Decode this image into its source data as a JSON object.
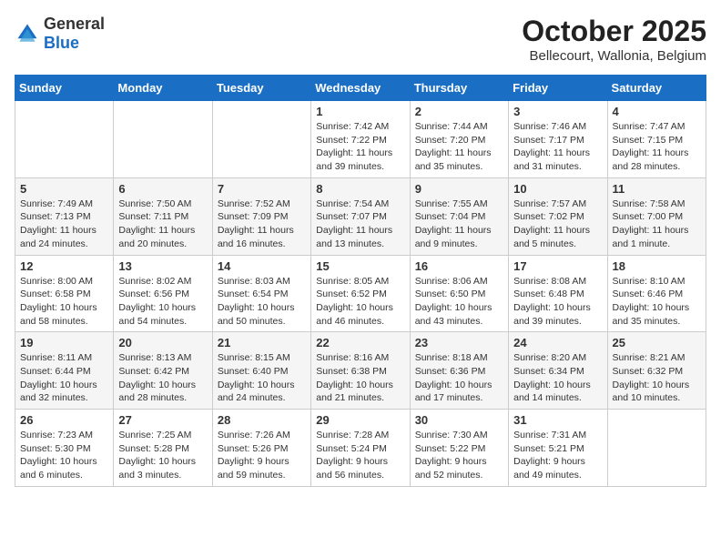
{
  "header": {
    "logo_general": "General",
    "logo_blue": "Blue",
    "month": "October 2025",
    "location": "Bellecourt, Wallonia, Belgium"
  },
  "weekdays": [
    "Sunday",
    "Monday",
    "Tuesday",
    "Wednesday",
    "Thursday",
    "Friday",
    "Saturday"
  ],
  "weeks": [
    [
      {
        "day": "",
        "info": ""
      },
      {
        "day": "",
        "info": ""
      },
      {
        "day": "",
        "info": ""
      },
      {
        "day": "1",
        "info": "Sunrise: 7:42 AM\nSunset: 7:22 PM\nDaylight: 11 hours\nand 39 minutes."
      },
      {
        "day": "2",
        "info": "Sunrise: 7:44 AM\nSunset: 7:20 PM\nDaylight: 11 hours\nand 35 minutes."
      },
      {
        "day": "3",
        "info": "Sunrise: 7:46 AM\nSunset: 7:17 PM\nDaylight: 11 hours\nand 31 minutes."
      },
      {
        "day": "4",
        "info": "Sunrise: 7:47 AM\nSunset: 7:15 PM\nDaylight: 11 hours\nand 28 minutes."
      }
    ],
    [
      {
        "day": "5",
        "info": "Sunrise: 7:49 AM\nSunset: 7:13 PM\nDaylight: 11 hours\nand 24 minutes."
      },
      {
        "day": "6",
        "info": "Sunrise: 7:50 AM\nSunset: 7:11 PM\nDaylight: 11 hours\nand 20 minutes."
      },
      {
        "day": "7",
        "info": "Sunrise: 7:52 AM\nSunset: 7:09 PM\nDaylight: 11 hours\nand 16 minutes."
      },
      {
        "day": "8",
        "info": "Sunrise: 7:54 AM\nSunset: 7:07 PM\nDaylight: 11 hours\nand 13 minutes."
      },
      {
        "day": "9",
        "info": "Sunrise: 7:55 AM\nSunset: 7:04 PM\nDaylight: 11 hours\nand 9 minutes."
      },
      {
        "day": "10",
        "info": "Sunrise: 7:57 AM\nSunset: 7:02 PM\nDaylight: 11 hours\nand 5 minutes."
      },
      {
        "day": "11",
        "info": "Sunrise: 7:58 AM\nSunset: 7:00 PM\nDaylight: 11 hours\nand 1 minute."
      }
    ],
    [
      {
        "day": "12",
        "info": "Sunrise: 8:00 AM\nSunset: 6:58 PM\nDaylight: 10 hours\nand 58 minutes."
      },
      {
        "day": "13",
        "info": "Sunrise: 8:02 AM\nSunset: 6:56 PM\nDaylight: 10 hours\nand 54 minutes."
      },
      {
        "day": "14",
        "info": "Sunrise: 8:03 AM\nSunset: 6:54 PM\nDaylight: 10 hours\nand 50 minutes."
      },
      {
        "day": "15",
        "info": "Sunrise: 8:05 AM\nSunset: 6:52 PM\nDaylight: 10 hours\nand 46 minutes."
      },
      {
        "day": "16",
        "info": "Sunrise: 8:06 AM\nSunset: 6:50 PM\nDaylight: 10 hours\nand 43 minutes."
      },
      {
        "day": "17",
        "info": "Sunrise: 8:08 AM\nSunset: 6:48 PM\nDaylight: 10 hours\nand 39 minutes."
      },
      {
        "day": "18",
        "info": "Sunrise: 8:10 AM\nSunset: 6:46 PM\nDaylight: 10 hours\nand 35 minutes."
      }
    ],
    [
      {
        "day": "19",
        "info": "Sunrise: 8:11 AM\nSunset: 6:44 PM\nDaylight: 10 hours\nand 32 minutes."
      },
      {
        "day": "20",
        "info": "Sunrise: 8:13 AM\nSunset: 6:42 PM\nDaylight: 10 hours\nand 28 minutes."
      },
      {
        "day": "21",
        "info": "Sunrise: 8:15 AM\nSunset: 6:40 PM\nDaylight: 10 hours\nand 24 minutes."
      },
      {
        "day": "22",
        "info": "Sunrise: 8:16 AM\nSunset: 6:38 PM\nDaylight: 10 hours\nand 21 minutes."
      },
      {
        "day": "23",
        "info": "Sunrise: 8:18 AM\nSunset: 6:36 PM\nDaylight: 10 hours\nand 17 minutes."
      },
      {
        "day": "24",
        "info": "Sunrise: 8:20 AM\nSunset: 6:34 PM\nDaylight: 10 hours\nand 14 minutes."
      },
      {
        "day": "25",
        "info": "Sunrise: 8:21 AM\nSunset: 6:32 PM\nDaylight: 10 hours\nand 10 minutes."
      }
    ],
    [
      {
        "day": "26",
        "info": "Sunrise: 7:23 AM\nSunset: 5:30 PM\nDaylight: 10 hours\nand 6 minutes."
      },
      {
        "day": "27",
        "info": "Sunrise: 7:25 AM\nSunset: 5:28 PM\nDaylight: 10 hours\nand 3 minutes."
      },
      {
        "day": "28",
        "info": "Sunrise: 7:26 AM\nSunset: 5:26 PM\nDaylight: 9 hours\nand 59 minutes."
      },
      {
        "day": "29",
        "info": "Sunrise: 7:28 AM\nSunset: 5:24 PM\nDaylight: 9 hours\nand 56 minutes."
      },
      {
        "day": "30",
        "info": "Sunrise: 7:30 AM\nSunset: 5:22 PM\nDaylight: 9 hours\nand 52 minutes."
      },
      {
        "day": "31",
        "info": "Sunrise: 7:31 AM\nSunset: 5:21 PM\nDaylight: 9 hours\nand 49 minutes."
      },
      {
        "day": "",
        "info": ""
      }
    ]
  ]
}
